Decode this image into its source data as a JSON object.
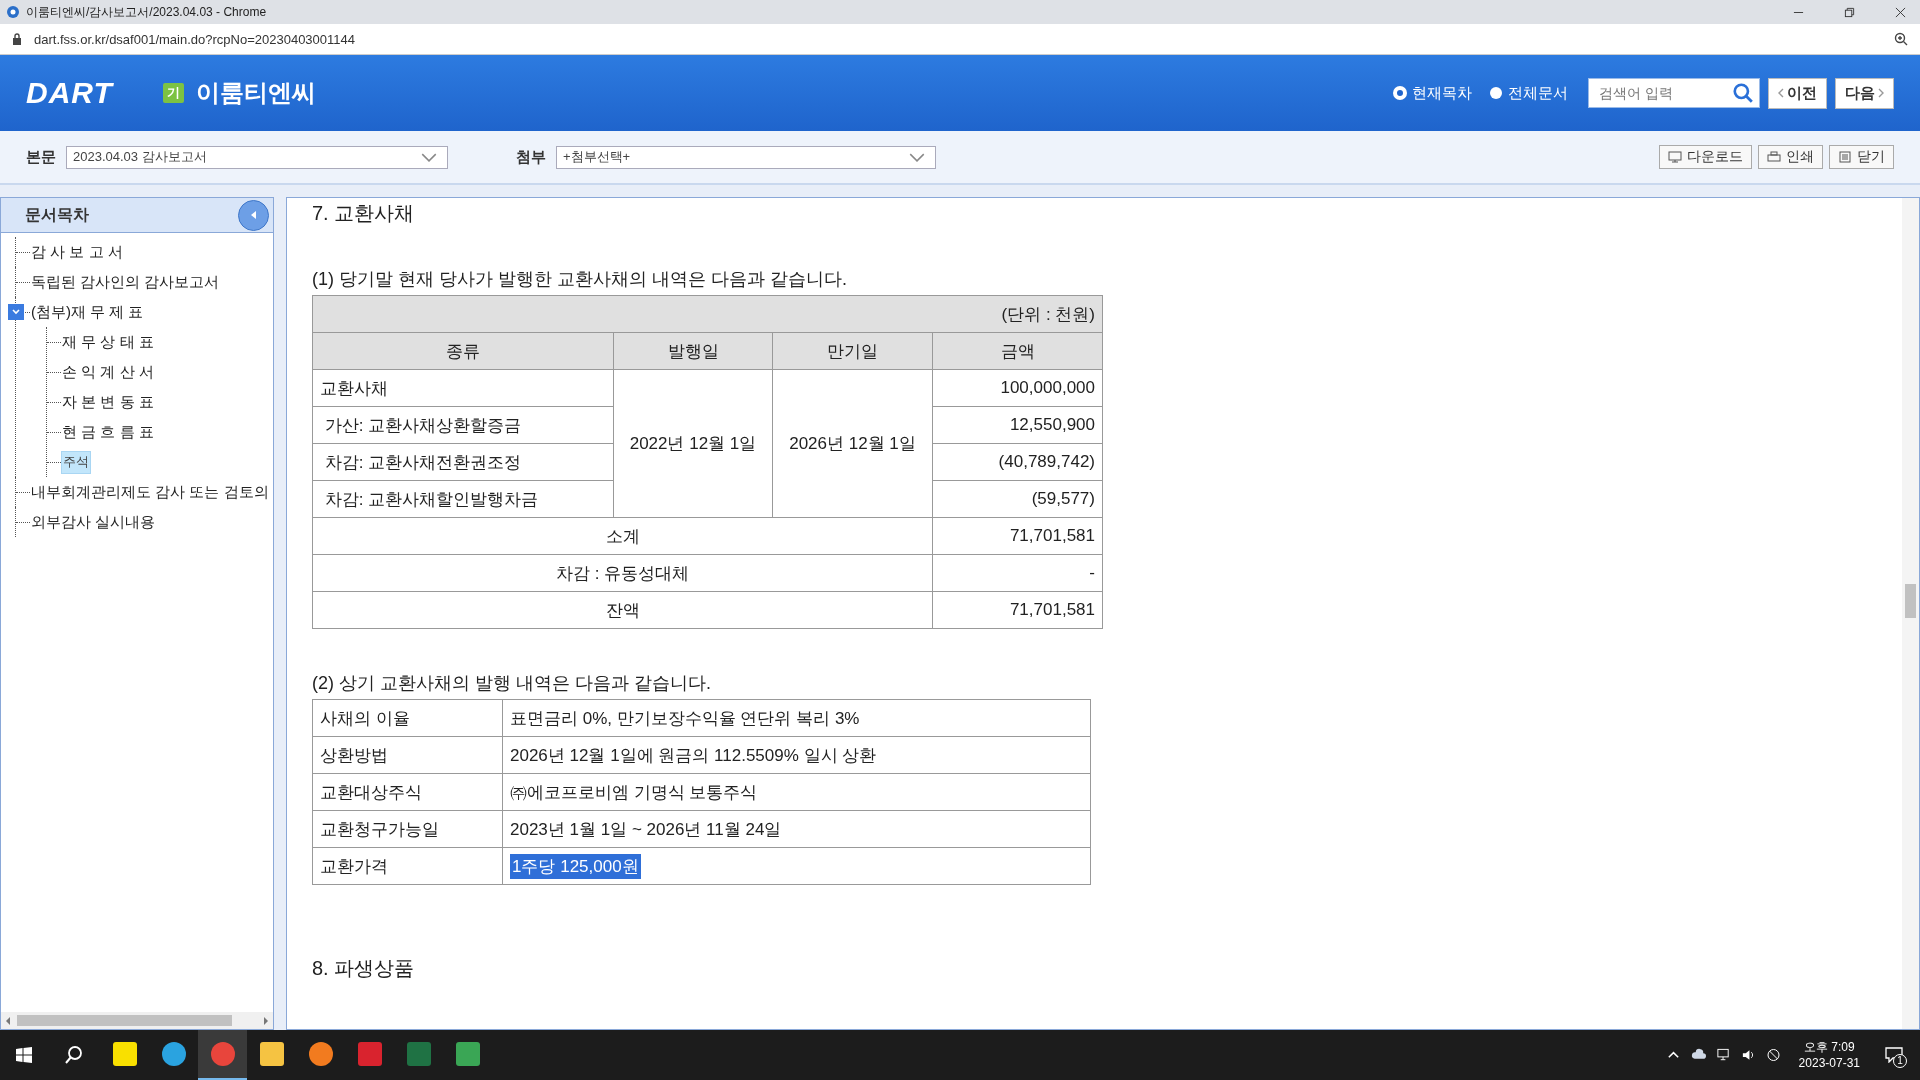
{
  "window": {
    "title": "이룸티엔씨/감사보고서/2023.04.03 - Chrome",
    "url": "dart.fss.or.kr/dsaf001/main.do?rcpNo=20230403001144"
  },
  "header": {
    "logo": "DART",
    "badge": "기",
    "company": "이룸티엔씨",
    "scopes": [
      {
        "label": "현재목차",
        "selected": true
      },
      {
        "label": "전체문서",
        "selected": false
      }
    ],
    "search": {
      "placeholder": "검색어 입력"
    },
    "prev": "이전",
    "next": "다음"
  },
  "toolbar": {
    "body_label": "본문",
    "body_value": "2023.04.03  감사보고서",
    "attach_label": "첨부",
    "attach_value": "+첨부선택+",
    "buttons": [
      {
        "kind": "download",
        "label": "다운로드"
      },
      {
        "kind": "print",
        "label": "인쇄"
      },
      {
        "kind": "close",
        "label": "닫기"
      }
    ]
  },
  "sidebar": {
    "title": "문서목차",
    "items": [
      {
        "label": "감 사 보 고 서",
        "selected": false
      },
      {
        "label": "독립된 감사인의 감사보고서",
        "selected": false
      },
      {
        "label": "(첨부)재 무 제 표",
        "selected": false,
        "expanded": true,
        "children": [
          {
            "label": "재 무 상 태 표",
            "selected": false
          },
          {
            "label": "손 익 계 산 서",
            "selected": false
          },
          {
            "label": "자 본 변 동 표",
            "selected": false
          },
          {
            "label": "현 금 흐 름 표",
            "selected": false
          },
          {
            "label": "주석",
            "selected": true
          }
        ]
      },
      {
        "label": "내부회계관리제도 감사 또는 검토의",
        "selected": false
      },
      {
        "label": "외부감사 실시내용",
        "selected": false
      }
    ]
  },
  "content": {
    "section_title": "7. 교환사채",
    "note1": "(1) 당기말 현재 당사가 발행한 교환사채의 내역은 다음과 같습니다.",
    "table1": {
      "unit": "(단위 : 천원)",
      "columns": [
        "종류",
        "발행일",
        "만기일",
        "금액"
      ],
      "rows": [
        {
          "label": "교환사채",
          "amount": "100,000,000"
        },
        {
          "label": " 가산: 교환사채상환할증금",
          "amount": "12,550,900"
        },
        {
          "label": " 차감: 교환사채전환권조정",
          "amount": "(40,789,742)"
        },
        {
          "label": " 차감: 교환사채할인발행차금",
          "amount": "(59,577)"
        }
      ],
      "issue_date": "2022년 12월 1일",
      "maturity_date": "2026년 12월 1일",
      "totals": [
        {
          "label": "소계",
          "amount": "71,701,581"
        },
        {
          "label": "차감 : 유동성대체",
          "amount": "-"
        },
        {
          "label": "잔액",
          "amount": "71,701,581"
        }
      ]
    },
    "note2": "(2) 상기 교환사채의 발행 내역은 다음과 같습니다.",
    "table2": [
      {
        "label": "사채의 이율",
        "value": "표면금리 0%, 만기보장수익율 연단위 복리 3%",
        "highlighted": false
      },
      {
        "label": "상환방법",
        "value": "2026년 12월 1일에 원금의 112.5509% 일시 상환",
        "highlighted": false
      },
      {
        "label": "교환대상주식",
        "value": "㈜에코프로비엠 기명식 보통주식",
        "highlighted": false
      },
      {
        "label": "교환청구가능일",
        "value": "2023년 1월 1일 ~ 2026년 11월 24일",
        "highlighted": false
      },
      {
        "label": "교환가격",
        "value": "1주당 125,000원",
        "highlighted": true
      }
    ],
    "next_section": "8. 파생상품"
  },
  "taskbar": {
    "apps": [
      {
        "kind": "talk"
      },
      {
        "kind": "telegram"
      },
      {
        "kind": "chrome",
        "selected": true
      },
      {
        "kind": "folder"
      },
      {
        "kind": "orange"
      },
      {
        "kind": "red"
      },
      {
        "kind": "excel"
      },
      {
        "kind": "green"
      }
    ],
    "time": "오후 7:09",
    "date": "2023-07-31",
    "notifications": "1"
  }
}
